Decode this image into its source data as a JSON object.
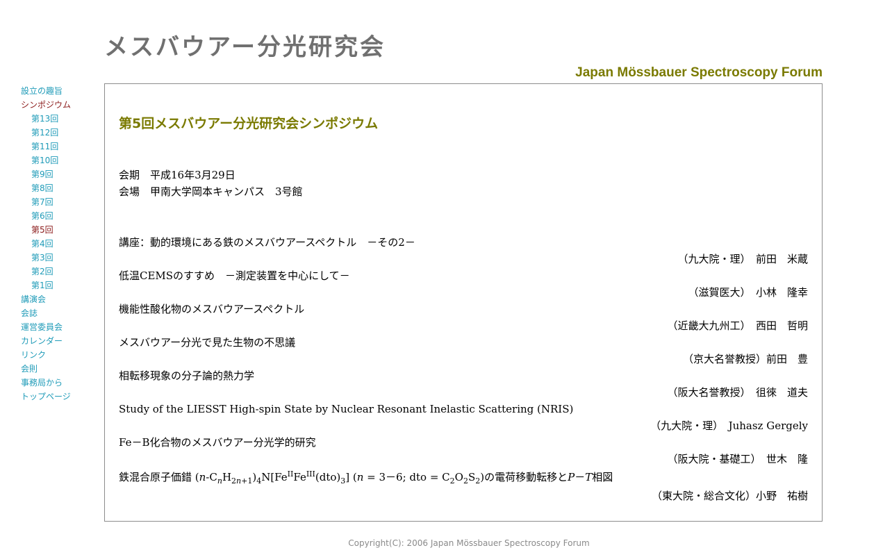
{
  "header": {
    "title": "メスバウアー分光研究会",
    "subtitle": "Japan Mössbauer Spectroscopy Forum"
  },
  "sidebar": {
    "items": [
      {
        "label": "設立の趣旨",
        "sub": false,
        "active": false
      },
      {
        "label": "シンポジウム",
        "sub": false,
        "active": true
      },
      {
        "label": "第13回",
        "sub": true,
        "active": false
      },
      {
        "label": "第12回",
        "sub": true,
        "active": false
      },
      {
        "label": "第11回",
        "sub": true,
        "active": false
      },
      {
        "label": "第10回",
        "sub": true,
        "active": false
      },
      {
        "label": "第9回",
        "sub": true,
        "active": false
      },
      {
        "label": "第8回",
        "sub": true,
        "active": false
      },
      {
        "label": "第7回",
        "sub": true,
        "active": false
      },
      {
        "label": "第6回",
        "sub": true,
        "active": false
      },
      {
        "label": "第5回",
        "sub": true,
        "active": true
      },
      {
        "label": "第4回",
        "sub": true,
        "active": false
      },
      {
        "label": "第3回",
        "sub": true,
        "active": false
      },
      {
        "label": "第2回",
        "sub": true,
        "active": false
      },
      {
        "label": "第1回",
        "sub": true,
        "active": false
      },
      {
        "label": "講演会",
        "sub": false,
        "active": false
      },
      {
        "label": "会誌",
        "sub": false,
        "active": false
      },
      {
        "label": "運営委員会",
        "sub": false,
        "active": false
      },
      {
        "label": "カレンダー",
        "sub": false,
        "active": false
      },
      {
        "label": "リンク",
        "sub": false,
        "active": false
      },
      {
        "label": "会則",
        "sub": false,
        "active": false
      },
      {
        "label": "事務局から",
        "sub": false,
        "active": false
      },
      {
        "label": "トップページ",
        "sub": false,
        "active": false
      }
    ]
  },
  "main": {
    "heading": "第5回メスバウアー分光研究会シンポジウム",
    "date_line": "会期　平成16年3月29日",
    "venue_line": "会場　甲南大学岡本キャンパス　3号館",
    "lectures": [
      {
        "title": "講座：動的環境にある鉄のメスバウアースペクトル　－その2－",
        "speaker": "（九大院・理）　前田　米蔵"
      },
      {
        "title": "低温CEMSのすすめ　－測定装置を中心にして－",
        "speaker": "（滋賀医大）　小林　隆幸"
      },
      {
        "title": "機能性酸化物のメスバウアースペクトル",
        "speaker": "（近畿大九州工）　西田　哲明"
      },
      {
        "title": "メスバウアー分光で見た生物の不思議",
        "speaker": "（京大名誉教授）前田　豊"
      },
      {
        "title": "相転移現象の分子論的熱力学",
        "speaker": "（阪大名誉教授）　徂徠　道夫"
      },
      {
        "title": "Study of the LIESST High-spin State by Nuclear Resonant Inelastic Scattering (NRIS)",
        "speaker": "（九大院・理）　Juhasz Gergely"
      },
      {
        "title": "Fe－B化合物のメスバウアー分光学的研究",
        "speaker": "（阪大院・基礎工）　世木　隆"
      }
    ],
    "last_lecture": {
      "title_parts": {
        "prefix": "鉄混合原子価錯 (",
        "n1": "n",
        "c": "-C",
        "n2": "n",
        "h": "H",
        "sub2n": "2",
        "n3": "n",
        "plus1": "+1",
        "close1": ")",
        "sub4": "4",
        "nfe": "N[Fe",
        "supII": "II",
        "fe": "Fe",
        "supIII": "III",
        "dto": "(dto)",
        "sub3": "3",
        "bracket": "] (",
        "n4": "n",
        "range": " = 3－6; dto = C",
        "subC": "2",
        "o": "O",
        "subO": "2",
        "s": "S",
        "subS": "2",
        "suffix": ")の電荷移動転移と",
        "p": "P",
        "dash": "－",
        "t": "T",
        "end": "相図"
      },
      "speaker": "（東大院・総合文化）小野　祐樹"
    }
  },
  "footer": {
    "copyright": "Copyright(C): 2006 Japan Mössbauer Spectroscopy Forum"
  },
  "colors": {
    "title_gray": "#707070",
    "accent_olive": "#7a7a00",
    "link_teal": "#1f9bb8",
    "active_maroon": "#8b1a1a",
    "border_gray": "#8c8c8c"
  }
}
